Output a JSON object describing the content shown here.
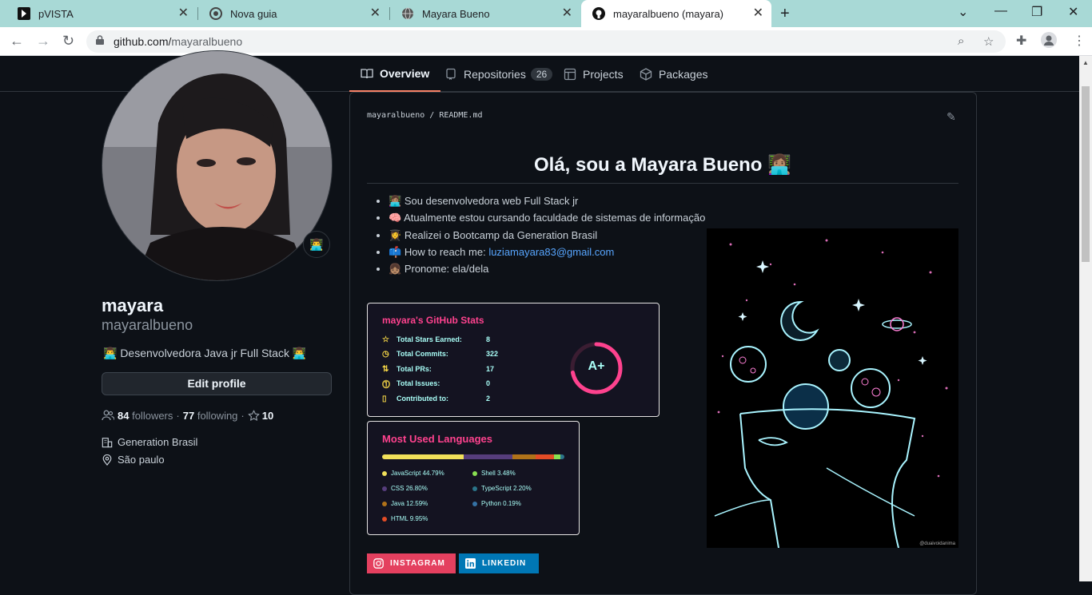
{
  "browser": {
    "tabs": [
      {
        "title": "pVISTA",
        "icon": "pvista-icon",
        "active": false
      },
      {
        "title": "Nova guia",
        "icon": "chrome-icon",
        "active": false
      },
      {
        "title": "Mayara Bueno",
        "icon": "globe-icon",
        "active": false
      },
      {
        "title": "mayaralbueno (mayara)",
        "icon": "github-icon",
        "active": true
      }
    ],
    "url_host": "github.com/",
    "url_path": "mayaralbueno"
  },
  "nav": {
    "overview": "Overview",
    "repositories": "Repositories",
    "repositories_count": "26",
    "projects": "Projects",
    "packages": "Packages"
  },
  "profile": {
    "status_emoji": "👨‍💻",
    "name": "mayara",
    "login": "mayaralbueno",
    "bio": "👨‍💻 Desenvolvedora Java jr Full Stack 👨‍💻",
    "edit_label": "Edit profile",
    "followers_count": "84",
    "followers_label": "followers",
    "following_count": "77",
    "following_label": "following",
    "stars_count": "10",
    "company": "Generation Brasil",
    "location": "São paulo"
  },
  "readme": {
    "owner": "mayaralbueno",
    "file": "README.md",
    "title": "Olá, sou a Mayara Bueno 👩🏽‍💻",
    "items": [
      {
        "emoji": "👩🏽‍💻",
        "text": "Sou desenvolvedora web Full Stack jr",
        "link": ""
      },
      {
        "emoji": "🧠",
        "text": "Atualmente estou cursando faculdade de sistemas de informação",
        "link": ""
      },
      {
        "emoji": "👩‍🎓",
        "text": "Realizei o Bootcamp da Generation Brasil",
        "link": ""
      },
      {
        "emoji": "📫",
        "text": "How to reach me: ",
        "link": "luziamayara83@gmail.com"
      },
      {
        "emoji": "👧🏽",
        "text": "Pronome: ela/dela",
        "link": ""
      }
    ],
    "art_signature": "@duaivoidanima"
  },
  "stats_card": {
    "title": "mayara's GitHub Stats",
    "rows": [
      {
        "icon": "star-icon",
        "label": "Total Stars Earned:",
        "value": "8"
      },
      {
        "icon": "history-icon",
        "label": "Total Commits:",
        "value": "322"
      },
      {
        "icon": "pull-request-icon",
        "label": "Total PRs:",
        "value": "17"
      },
      {
        "icon": "issue-icon",
        "label": "Total Issues:",
        "value": "0"
      },
      {
        "icon": "repo-icon",
        "label": "Contributed to:",
        "value": "2"
      }
    ],
    "grade": "A+",
    "grade_progress": 0.72,
    "colors": {
      "title": "#fe428e",
      "text": "#a9fef7",
      "icon": "#f8d847",
      "bg": "#141321"
    }
  },
  "langs_card": {
    "title": "Most Used Languages",
    "languages": [
      {
        "name": "JavaScript",
        "percent": "44.79%",
        "value": 44.79,
        "color": "#f1e05a"
      },
      {
        "name": "CSS",
        "percent": "26.80%",
        "value": 26.8,
        "color": "#563d7c"
      },
      {
        "name": "Java",
        "percent": "12.59%",
        "value": 12.59,
        "color": "#b07219"
      },
      {
        "name": "HTML",
        "percent": "9.95%",
        "value": 9.95,
        "color": "#e34c26"
      },
      {
        "name": "Shell",
        "percent": "3.48%",
        "value": 3.48,
        "color": "#89e051"
      },
      {
        "name": "TypeScript",
        "percent": "2.20%",
        "value": 2.2,
        "color": "#2b7489"
      },
      {
        "name": "Python",
        "percent": "0.19%",
        "value": 0.19,
        "color": "#3572A5"
      }
    ]
  },
  "badges": {
    "instagram": "INSTAGRAM",
    "linkedin": "LINKEDIN",
    "instagram_color": "#e4405f",
    "linkedin_color": "#0077b5"
  }
}
